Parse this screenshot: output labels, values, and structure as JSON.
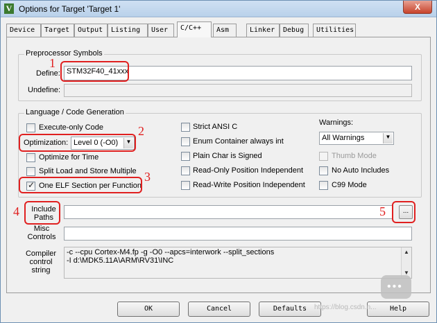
{
  "window": {
    "title": "Options for Target 'Target 1'",
    "icon_name": "keil-uvision-icon",
    "close_symbol": "X"
  },
  "tabs": [
    "Device",
    "Target",
    "Output",
    "Listing",
    "User",
    "C/C++",
    "Asm",
    "Linker",
    "Debug",
    "Utilities"
  ],
  "active_tab": "C/C++",
  "preprocessor": {
    "group_label": "Preprocessor Symbols",
    "define_label": "Define:",
    "define_value": "STM32F40_41xxx",
    "undefine_label": "Undefine:",
    "undefine_value": ""
  },
  "language": {
    "group_label": "Language / Code Generation",
    "execute_only": {
      "label": "Execute-only Code",
      "checked": false
    },
    "optimization_label": "Optimization:",
    "optimization_value": "Level 0 (-O0)",
    "optimize_time": {
      "label": "Optimize for Time",
      "checked": false
    },
    "split_load": {
      "label": "Split Load and Store Multiple",
      "checked": false
    },
    "one_elf": {
      "label": "One ELF Section per Function",
      "checked": true
    },
    "strict_ansi": {
      "label": "Strict ANSI C",
      "checked": false
    },
    "enum_container": {
      "label": "Enum Container always int",
      "checked": false
    },
    "plain_char": {
      "label": "Plain Char is Signed",
      "checked": false
    },
    "ro_position": {
      "label": "Read-Only Position Independent",
      "checked": false
    },
    "rw_position": {
      "label": "Read-Write Position Independent",
      "checked": false
    },
    "warnings_label": "Warnings:",
    "warnings_value": "All Warnings",
    "thumb_mode": {
      "label": "Thumb Mode",
      "checked": false,
      "enabled": false
    },
    "no_auto_includes": {
      "label": "No Auto Includes",
      "checked": false
    },
    "c99_mode": {
      "label": "C99 Mode",
      "checked": false
    }
  },
  "paths": {
    "include_label_line1": "Include",
    "include_label_line2": "Paths",
    "include_value": "",
    "browse_label": "...",
    "misc_label_line1": "Misc",
    "misc_label_line2": "Controls",
    "misc_value": ""
  },
  "compiler": {
    "label_line1": "Compiler",
    "label_line2": "control",
    "label_line3": "string",
    "line1": "-c --cpu Cortex-M4.fp -g -O0 --apcs=interwork --split_sections",
    "line2": "-I d:\\MDK5.11A\\ARM\\RV31\\INC"
  },
  "annotations": [
    "1",
    "2",
    "3",
    "4",
    "5"
  ],
  "annotation_color": "#e02020",
  "footer": {
    "ok": "OK",
    "cancel": "Cancel",
    "defaults": "Defaults",
    "help": "Help"
  },
  "watermark": "https://blog.csdn.n...",
  "watermark_icon": "chat-bubble-icon"
}
